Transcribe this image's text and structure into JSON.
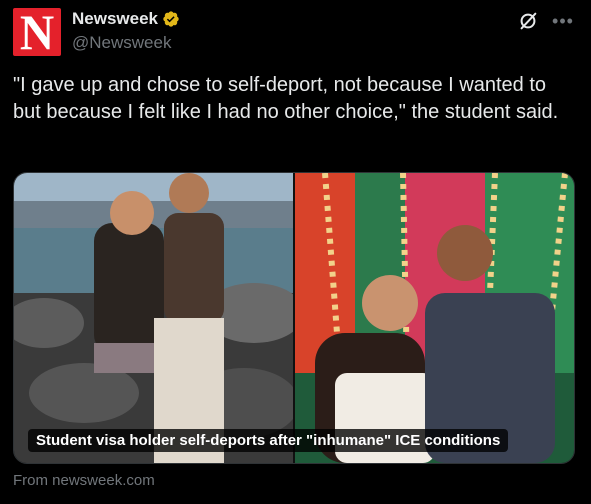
{
  "author": {
    "display_name": "Newsweek",
    "handle": "@Newsweek",
    "avatar_letter": "N",
    "verified_icon": "verified-gold-badge-icon"
  },
  "header_icons": {
    "grok": "grok-icon",
    "more": "more-options-icon"
  },
  "tweet": {
    "text": "\"I gave up and chose to self-deport, not because I wanted to but because I felt like I had no other choice,\" the student said."
  },
  "card": {
    "caption": "Student visa holder self-deports after \"inhumane\" ICE conditions",
    "source": "From newsweek.com"
  },
  "colors": {
    "background": "#000000",
    "text": "#e7e9ea",
    "secondary_text": "#71767b",
    "brand_red": "#e4212b",
    "verified_gold": "#e2b719"
  }
}
